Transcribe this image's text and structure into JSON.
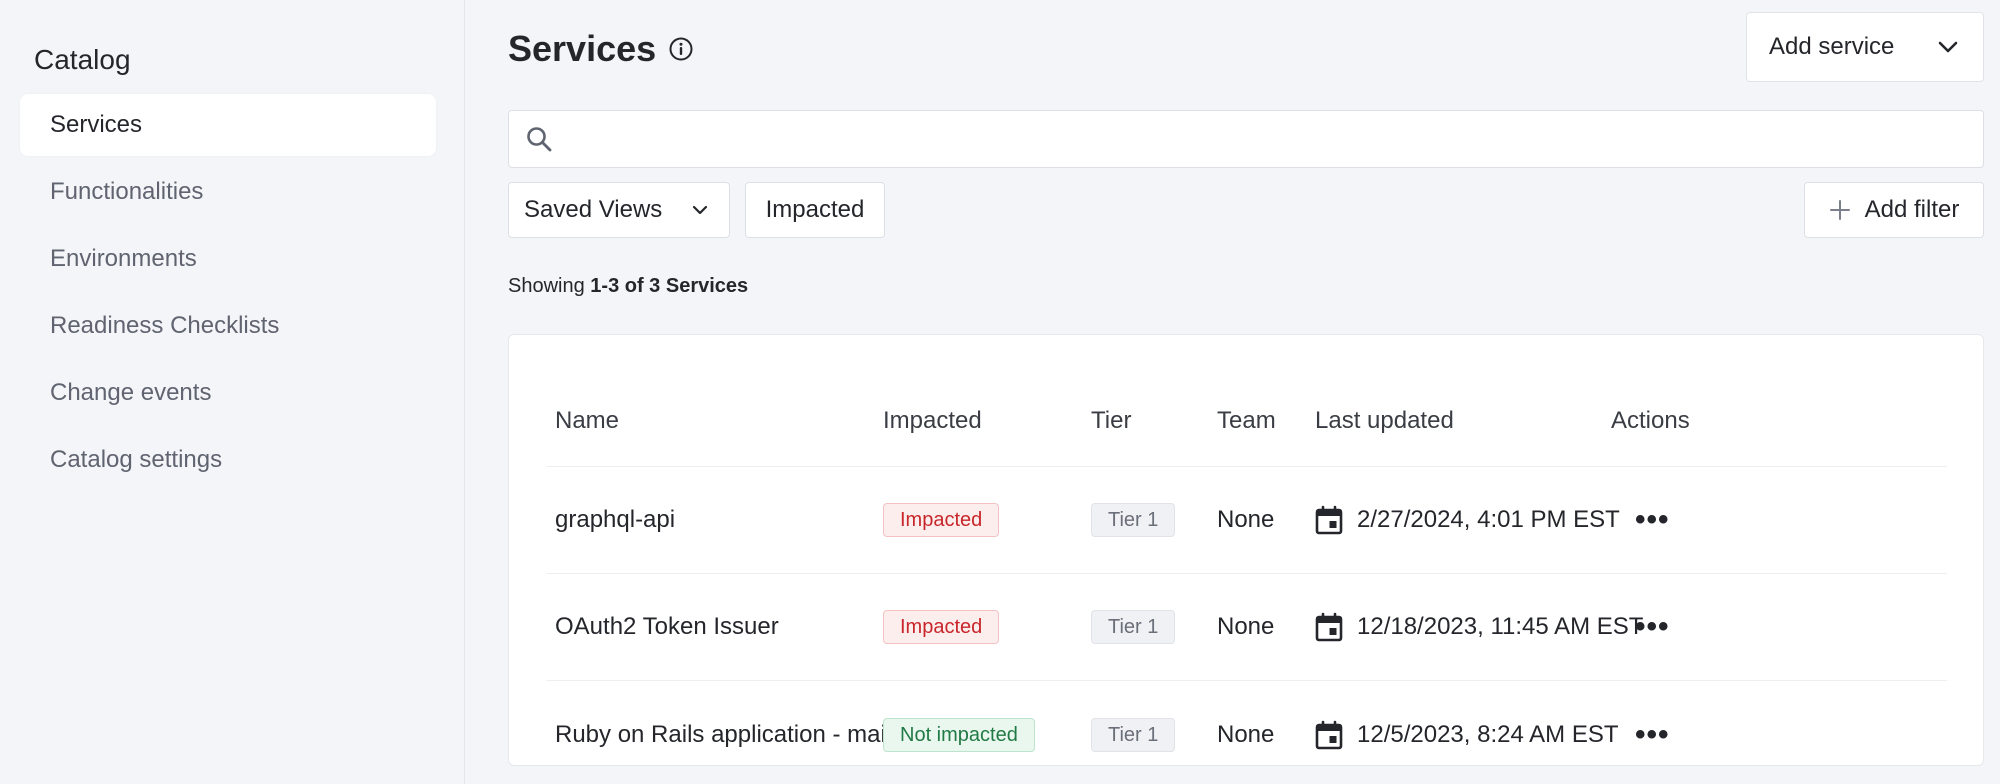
{
  "sidebar": {
    "title": "Catalog",
    "items": [
      {
        "label": "Services",
        "active": true
      },
      {
        "label": "Functionalities"
      },
      {
        "label": "Environments"
      },
      {
        "label": "Readiness Checklists"
      },
      {
        "label": "Change events"
      },
      {
        "label": "Catalog settings"
      }
    ]
  },
  "header": {
    "title": "Services",
    "info_icon": "info-circle-icon",
    "add_service_label": "Add service"
  },
  "search": {
    "value": "",
    "placeholder": ""
  },
  "filters": {
    "saved_views_label": "Saved Views",
    "impacted_label": "Impacted",
    "add_filter_label": "Add filter"
  },
  "summary": {
    "prefix": "Showing",
    "range": "1-3 of 3 Services"
  },
  "table": {
    "columns": [
      "Name",
      "Impacted",
      "Tier",
      "Team",
      "Last updated",
      "Actions"
    ],
    "rows": [
      {
        "name": "graphql-api",
        "impacted": "Impacted",
        "tier": "Tier 1",
        "team": "None",
        "updated": "2/27/2024, 4:01 PM EST"
      },
      {
        "name": "OAuth2 Token Issuer",
        "impacted": "Impacted",
        "tier": "Tier 1",
        "team": "None",
        "updated": "12/18/2023, 11:45 AM EST"
      },
      {
        "name": "Ruby on Rails application - main",
        "impacted": "Not impacted",
        "tier": "Tier 1",
        "team": "None",
        "updated": "12/5/2023, 8:24 AM EST"
      }
    ]
  },
  "colors": {
    "impacted_text": "#c8262a",
    "not_impacted_text": "#217a45",
    "background": "#f4f5f8"
  }
}
